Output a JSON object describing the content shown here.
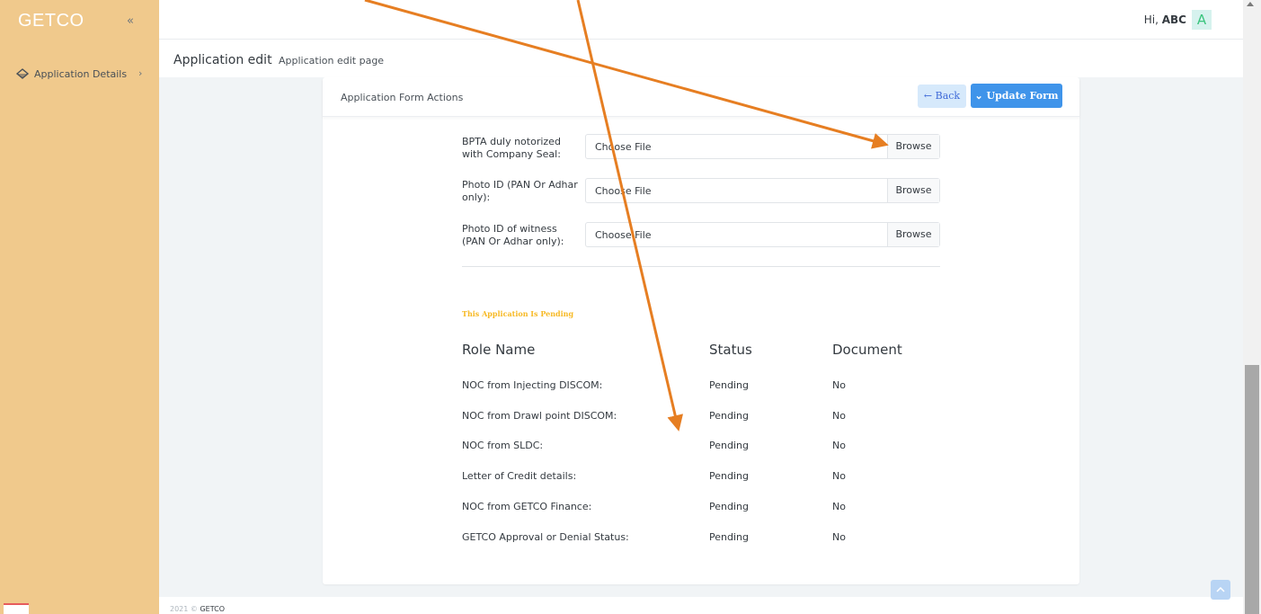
{
  "sidebar": {
    "brand": "GETCO",
    "collapse_icon": "«",
    "items": [
      {
        "label": "Application Details",
        "icon": "diamond-icon",
        "chevron": "›"
      }
    ]
  },
  "header": {
    "greeting_prefix": "Hi,",
    "user_name": "ABC",
    "avatar_letter": "A"
  },
  "page": {
    "title": "Application edit",
    "subtitle": "Application edit page"
  },
  "card": {
    "title": "Application Form Actions",
    "back_label": "← Back",
    "update_label": "⌄ Update Form"
  },
  "uploads": [
    {
      "label": "BPTA duly notorized with Company Seal:",
      "placeholder": "Choose File",
      "button": "Browse"
    },
    {
      "label": "Photo ID (PAN Or Adhar only):",
      "placeholder": "Choose File",
      "button": "Browse"
    },
    {
      "label": "Photo ID of witness (PAN Or Adhar only):",
      "placeholder": "Choose File",
      "button": "Browse"
    }
  ],
  "status": {
    "notice": "This Application Is Pending",
    "columns": [
      "Role Name",
      "Status",
      "Document"
    ],
    "rows": [
      {
        "role": "NOC from Injecting DISCOM:",
        "status": "Pending",
        "document": "No"
      },
      {
        "role": "NOC from Drawl point DISCOM:",
        "status": "Pending",
        "document": "No"
      },
      {
        "role": "NOC from SLDC:",
        "status": "Pending",
        "document": "No"
      },
      {
        "role": "Letter of Credit details:",
        "status": "Pending",
        "document": "No"
      },
      {
        "role": "NOC from GETCO Finance:",
        "status": "Pending",
        "document": "No"
      },
      {
        "role": "GETCO Approval or Denial Status:",
        "status": "Pending",
        "document": "No"
      }
    ]
  },
  "footer": {
    "copyright": "2021 ©",
    "brand": "GETCO"
  },
  "colors": {
    "sidebar_bg": "#f0c98c",
    "primary": "#3f94ea",
    "warning": "#f7b924",
    "annotation_arrow": "#e67e22"
  }
}
